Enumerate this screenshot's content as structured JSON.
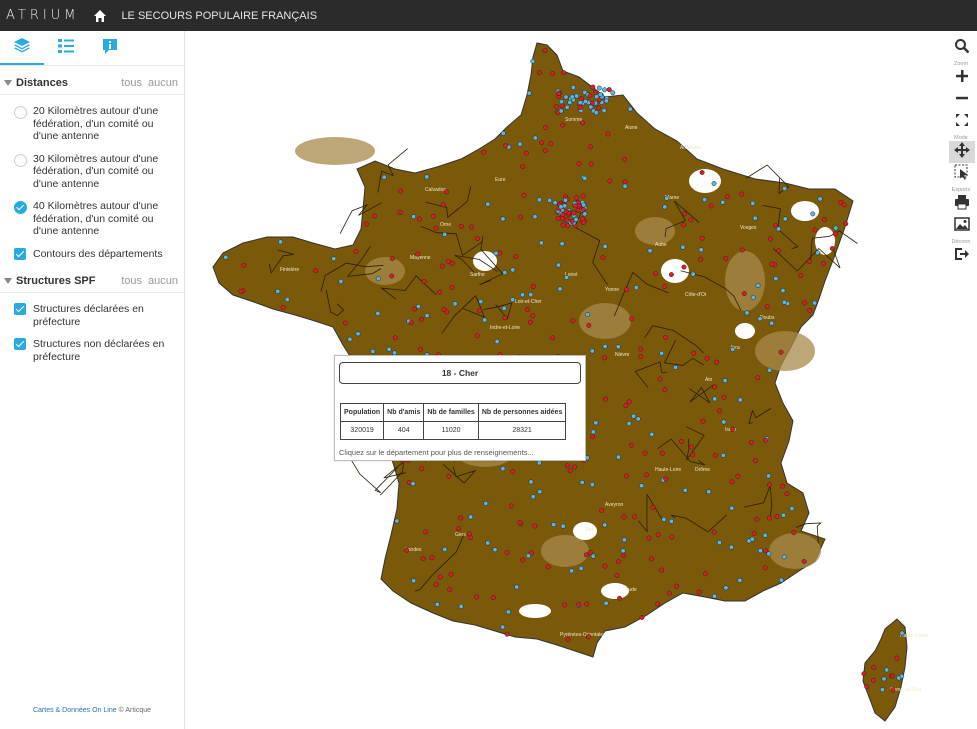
{
  "header": {
    "brand": "ATRIUM",
    "title": "LE SECOURS POPULAIRE FRANÇAIS"
  },
  "sidebar": {
    "tabs": [
      {
        "icon": "layers-icon",
        "active": true
      },
      {
        "icon": "legend-list-icon",
        "active": false
      },
      {
        "icon": "info-icon",
        "active": false
      }
    ],
    "sections": [
      {
        "title": "Distances",
        "all_label": "tous",
        "none_label": "aucun",
        "options": [
          {
            "label": "20 Kilomètres autour d'une fédération, d'un comité ou d'une antenne",
            "type": "radio",
            "checked": false
          },
          {
            "label": "30 Kilomètres autour d'une fédération, d'un comité ou d'une antenne",
            "type": "radio",
            "checked": false
          },
          {
            "label": "40 Kilomètres autour d'une fédération, d'un comité ou d'une antenne",
            "type": "radio",
            "checked": true
          },
          {
            "label": "Contours des départements",
            "type": "checkbox",
            "checked": true
          }
        ]
      },
      {
        "title": "Structures SPF",
        "all_label": "tous",
        "none_label": "aucun",
        "options": [
          {
            "label": "Structures déclarées en préfecture",
            "type": "checkbox",
            "checked": true
          },
          {
            "label": "Structures non déclarées en préfecture",
            "type": "checkbox",
            "checked": true
          }
        ]
      }
    ],
    "credits": {
      "link": "Cartes & Données On Line",
      "suffix": "© Articque"
    }
  },
  "toolbar": {
    "zoom_label": "Zoom",
    "mode_label": "Mode",
    "exports_label": "Exports",
    "logout_label": "Déconn"
  },
  "popup": {
    "title": "18 - Cher",
    "headers": [
      "Population",
      "Nb d'amis",
      "Nb de familles",
      "Nb de personnes aidées"
    ],
    "values": [
      "320019",
      "404",
      "11020",
      "28321"
    ],
    "footer": "Cliquez sur le département pour plus de renseignements..."
  },
  "map": {
    "fill_color": "#7a5a0a",
    "light_fill_color": "#a88a4a",
    "declared_color": "#e01b24",
    "undeclared_color": "#5bb6e6",
    "labels": [
      "Somme",
      "Aisne",
      "Ardennes",
      "Marne",
      "Calvados",
      "Eure",
      "Orne",
      "Mayenne",
      "Sarthe",
      "Loir-et-Cher",
      "Loiret",
      "Yonne",
      "Aube",
      "Vosges",
      "Doubs",
      "Jura",
      "Ain",
      "Isère",
      "Drôme",
      "Haute-Loire",
      "Aveyron",
      "Tarn",
      "Gers",
      "Landes",
      "Gironde",
      "Vienne",
      "Indre-et-Loire",
      "Vendée",
      "Finistère",
      "Côte-d'Or",
      "Nièvre",
      "Aude",
      "Pyrénées-Orientales",
      "Haute-Corse",
      "Corse-du-Sud"
    ]
  }
}
